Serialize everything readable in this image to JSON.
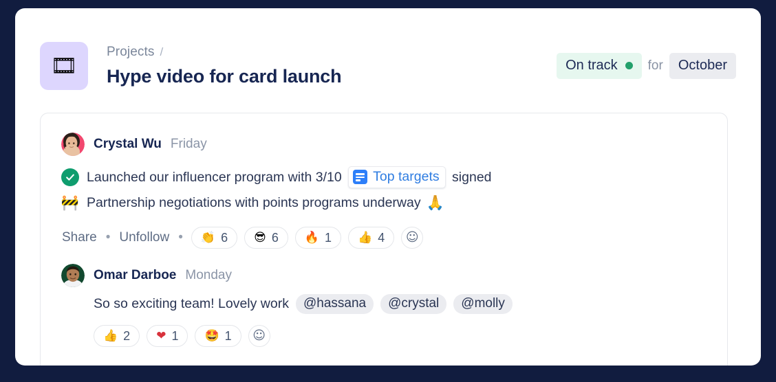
{
  "header": {
    "project_icon": "film-strip-icon",
    "project_icon_glyph": "🎞",
    "breadcrumb_parent": "Projects",
    "breadcrumb_separator": "/",
    "title": "Hype video for card launch",
    "status_label": "On track",
    "status_color": "#22a06b",
    "for_label": "for",
    "period_label": "October"
  },
  "post": {
    "author": "Crystal Wu",
    "timestamp": "Friday",
    "lines": [
      {
        "icon": "green-check-icon",
        "text_before": "Launched our influencer program with 3/10 ",
        "link_label": "Top targets",
        "link_icon": "document-list-icon",
        "text_after": " signed",
        "trailing_emoji": ""
      },
      {
        "icon": "construction-icon",
        "icon_glyph": "🚧",
        "text_before": "Partnership negotiations with points programs underway",
        "link_label": "",
        "text_after": "",
        "trailing_emoji": "🙏"
      }
    ],
    "share_label": "Share",
    "unfollow_label": "Unfollow",
    "separator": "•",
    "reactions": [
      {
        "emoji": "👏",
        "name": "clap-reaction",
        "count": "6"
      },
      {
        "emoji": "😎",
        "name": "sunglasses-reaction",
        "count": "6"
      },
      {
        "emoji": "🔥",
        "name": "fire-reaction",
        "count": "1"
      },
      {
        "emoji": "👍",
        "name": "thumbsup-reaction",
        "count": "4"
      }
    ],
    "add_reaction_glyph": "☺"
  },
  "comment": {
    "author": "Omar Darboe",
    "timestamp": "Monday",
    "text": "So so exciting team! Lovely work",
    "mentions": [
      "@hassana",
      "@crystal",
      "@molly"
    ],
    "reactions": [
      {
        "emoji": "👍",
        "name": "thumbsup-reaction",
        "count": "2"
      },
      {
        "emoji": "❤",
        "name": "heart-reaction",
        "count": "1"
      },
      {
        "emoji": "🤩",
        "name": "starstruck-reaction",
        "count": "1"
      }
    ],
    "add_reaction_glyph": "☺"
  }
}
